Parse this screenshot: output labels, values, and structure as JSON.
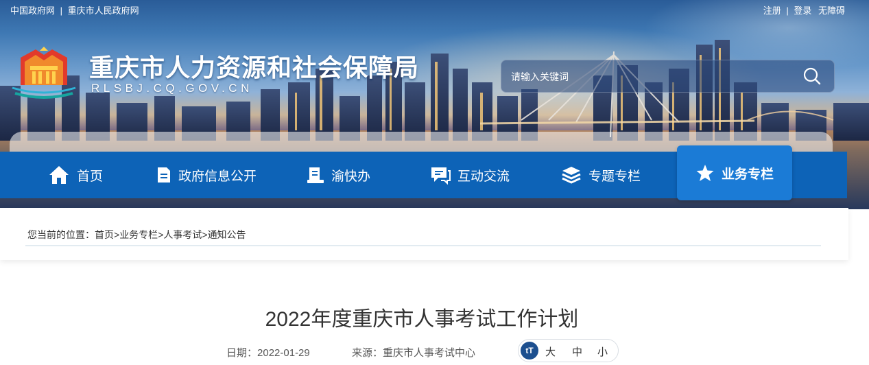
{
  "topbar": {
    "left_links": [
      "中国政府网",
      "重庆市人民政府网"
    ],
    "separator": "|",
    "right_links": [
      "注册",
      "登录",
      "无障碍"
    ]
  },
  "header": {
    "site_title": "重庆市人力资源和社会保障局",
    "site_url": "RLSBJ.CQ.GOV.CN",
    "logo_icon": "logo-emblem-icon"
  },
  "search": {
    "placeholder": "请输入关键词",
    "button_icon": "search-icon"
  },
  "nav": {
    "items": [
      {
        "label": "首页",
        "icon": "home-icon"
      },
      {
        "label": "政府信息公开",
        "icon": "document-icon"
      },
      {
        "label": "渝快办",
        "icon": "clipboard-icon"
      },
      {
        "label": "互动交流",
        "icon": "chat-icon"
      },
      {
        "label": "专题专栏",
        "icon": "layers-icon"
      },
      {
        "label": "业务专栏",
        "icon": "star-icon",
        "active": true
      }
    ]
  },
  "breadcrumb": {
    "prefix": "您当前的位置：",
    "items": [
      "首页",
      "业务专栏",
      "人事考试",
      "通知公告"
    ],
    "separator": ">"
  },
  "article": {
    "title": "2022年度重庆市人事考试工作计划",
    "date_label": "日期：",
    "date": "2022-01-29",
    "source_label": "来源：",
    "source": "重庆市人事考试中心",
    "font_size": {
      "icon_text": "tT",
      "large": "大",
      "medium": "中",
      "small": "小"
    }
  },
  "colors": {
    "nav_bg": "#0d63b7",
    "nav_active_bg": "#1b7bd6",
    "title_text": "#333333"
  }
}
